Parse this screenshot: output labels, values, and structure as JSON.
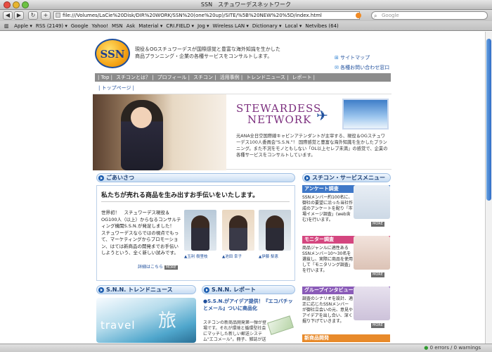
{
  "window": {
    "title": "SSN　スチュワーデスネットワーク"
  },
  "toolbar": {
    "back": "◀",
    "forward": "▶",
    "reload": "↻",
    "add": "+",
    "url": "file:///Volumes/LaCie%20Disk/DIR%20WORK/SSN%20(one%20up)/SITE/%5B%20NEW%20%5D/index.html",
    "search_placeholder": "Google"
  },
  "bookmarks": [
    "Apple ▾",
    "RSS (2149) ▾",
    "Google",
    "Yahoo!",
    "MSN",
    "Ask",
    "Material ▾",
    "CRI.FIELD ▾",
    "Jog ▾",
    "Wireless LAN ▾",
    "Dictionary ▾",
    "Local ▾",
    "Netvibes (64)"
  ],
  "header": {
    "logo": "SSN",
    "tagline_1": "現役＆OGスチュワーデスが国際感覚と豊富な海外知識を生かした",
    "tagline_2": "商品プランニング・企業の各種サービスをコンサルトします。",
    "sitemap": "サイトマップ",
    "contact": "各種お問い合わせ窓口"
  },
  "nav": {
    "items": [
      "| Top |",
      "スチコンとは？ |",
      "プロフィール |",
      "スチコン |",
      "活用事例 |",
      "トレンドニュース |",
      "レポート |"
    ],
    "second": "| トップページ |"
  },
  "hero": {
    "title_1": "STEWARDESS",
    "title_2": "NETWORK",
    "desc": "元ANA全日空国際線キャビンアテンダントが主宰する、現役＆OGスチュワーデス100人委員会\"S.S.N.\"！ 国際感覚と豊富な海外知識を生かしたプランニング。また不況をモノともしない「OL以上セレブ未満」の感覚で、企業の各種サービスをコンサルトしています。"
  },
  "greeting": {
    "header": "ごあいさつ",
    "headline": "私たちが売れる商品を生み出すお手伝いをいたします。",
    "body": "世界初！　スチュワーデス現役＆OG100人（以上）からなるコンサルティング機関S.S.N.が発足しました！　スチュワーデスならではの視点でもって、マーケティングからプロモーション、はては新商品の開発までお手伝いしようという、全く新しい試みです。",
    "more": "詳細はこちら",
    "more_badge": "MORE",
    "people": [
      "玉利 樹里枝",
      "池田 幸子",
      "伊藤 梨恵"
    ]
  },
  "services": {
    "header": "スチコン・サービスメニュー",
    "items": [
      {
        "title": "アンケート調査",
        "text": "SSNメンバー約100名に、御社の要望に沿った当社作成のアンケートを配り「市場イメージ調査」(web含む)を行います。",
        "badge": "MORE"
      },
      {
        "title": "モニター調査",
        "text": "商品ジャンルに適性あるSSNメンバー10〜30名を選抜し、実際に商品を使用して「モニタリング調査」を行います。",
        "badge": "MORE"
      },
      {
        "title": "グループインタビュー",
        "text": "調査のシナリオを設計、適正に応じたSSNメンバーが御社立会いの元、意見やアイデアを出し合い、深く掘り下げていきます。",
        "badge": "MORE"
      },
      {
        "title": "新商品開発",
        "text": "",
        "badge": ""
      }
    ]
  },
  "trend": {
    "header": "S.N.N. トレンドニュース",
    "image_text": "travel"
  },
  "report": {
    "header": "S.N.N. レポート",
    "title": "●S.S.N.がアイデア提供！『エコバチッとメール』ついに商品化",
    "body": "スチコンの新商品開発第一弾が登場です。それが環境と循環型社会にマッチした新しい郵送システム\"エコメール\"。冊子、雑誌が送られてきた時の..."
  },
  "status": {
    "text": "0 errors / 0 warnings"
  },
  "colors": {
    "nav_bg": "#8c8c8c",
    "brand_blue": "#1f4f9c",
    "svc_blue": "#3f78c8",
    "svc_pink": "#d4467f",
    "svc_purple": "#8a5bb8",
    "svc_orange": "#e88a2a"
  }
}
